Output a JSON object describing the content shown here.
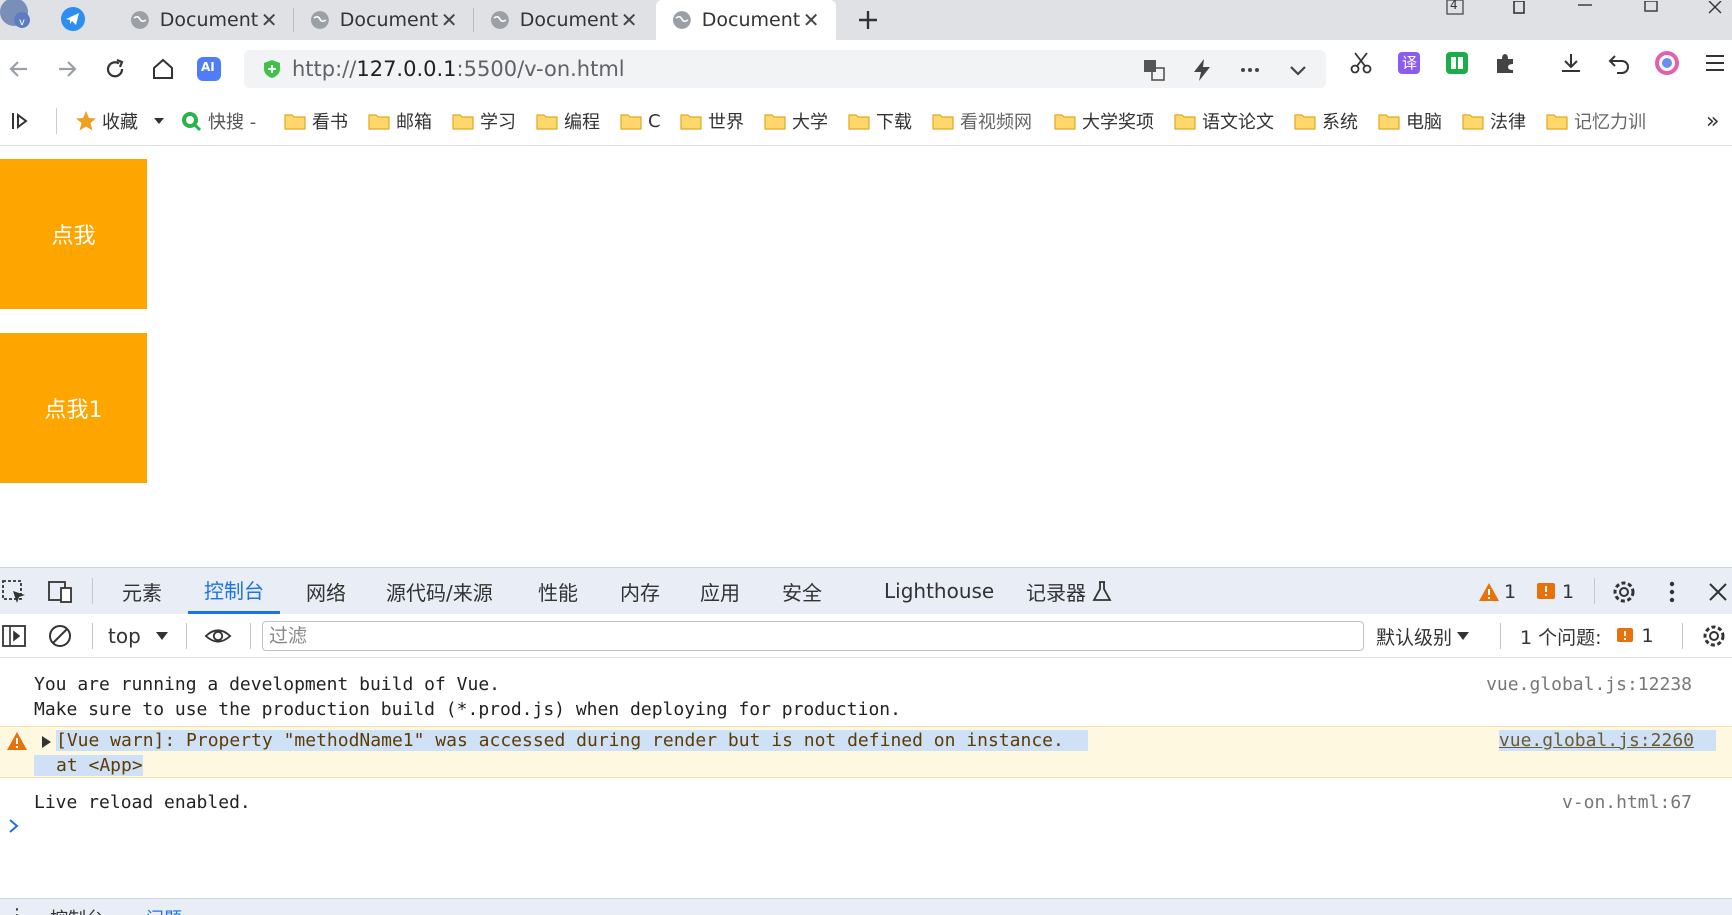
{
  "browser": {
    "tabs": [
      {
        "title": "Document",
        "active": false
      },
      {
        "title": "Document",
        "active": false
      },
      {
        "title": "Document",
        "active": false
      },
      {
        "title": "Document",
        "active": true
      }
    ],
    "tab_close_glyph": "✕",
    "window_badge": "4",
    "url": {
      "scheme": "http://",
      "host": "127.0.0.1",
      "rest": ":5500/v-on.html"
    },
    "ai_label": "AI",
    "translate_label": "译"
  },
  "bookmarks": {
    "favorites": "收藏",
    "quick_search": "快搜 -",
    "folders": [
      "看书",
      "邮箱",
      "学习",
      "编程",
      "C",
      "世界",
      "大学",
      "下载",
      "看视频网",
      "大学奖项",
      "语文论文",
      "系统",
      "电脑",
      "法律",
      "记忆力训"
    ],
    "more": "»"
  },
  "page": {
    "button1": "点我",
    "button2": "点我1"
  },
  "devtools": {
    "tabs": [
      "元素",
      "控制台",
      "网络",
      "源代码/来源",
      "性能",
      "内存",
      "应用",
      "安全",
      "Lighthouse",
      "记录器"
    ],
    "active_tab": "控制台",
    "warning_count": "1",
    "error_count": "1",
    "context": "top",
    "filter_placeholder": "过滤",
    "level": "默认级别",
    "issues_label": "1 个问题:",
    "issues_count": "1",
    "messages": [
      {
        "lines": [
          "You are running a development build of Vue.",
          "Make sure to use the production build (*.prod.js) when deploying for production."
        ],
        "source": "vue.global.js:12238",
        "level": "info"
      },
      {
        "lines": [
          "[Vue warn]: Property \"methodName1\" was accessed during render but is not defined on instance.",
          "at <App>"
        ],
        "source": "vue.global.js:2260",
        "level": "warning"
      },
      {
        "lines": [
          "Live reload enabled."
        ],
        "source": "v-on.html:67",
        "level": "info"
      }
    ],
    "drawer_tabs": [
      "控制台",
      "问题"
    ]
  },
  "colors": {
    "accent": "#1a73e8",
    "orange_button": "#ffa500",
    "warning": "#e8710a",
    "error": "#e8710a"
  }
}
